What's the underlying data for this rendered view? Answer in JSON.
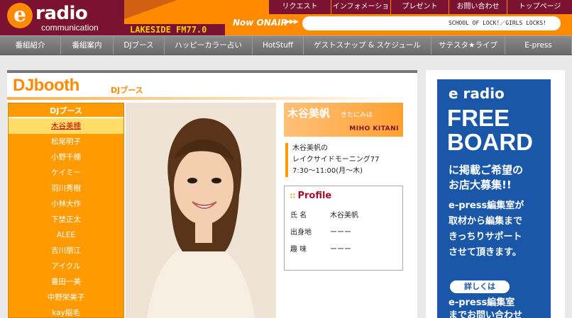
{
  "header": {
    "logo_mark": "e",
    "logo_word": "radio",
    "logo_sub": "communication",
    "station": "LAKESIDE FM77.0",
    "now_onair_label": "Now ONAIR",
    "now_onair_arrows": "▶▶▶",
    "now_onair_text": "SCHOOL OF LOCK!／GIRLS LOCKS!"
  },
  "topnav": [
    {
      "label": "リクエスト"
    },
    {
      "label": "インフォメーション"
    },
    {
      "label": "プレゼント"
    },
    {
      "label": "お問い合わせ"
    },
    {
      "label": "トップページ"
    }
  ],
  "mainnav": [
    {
      "label": "番組紹介"
    },
    {
      "label": "番組案内"
    },
    {
      "label": "DJブース"
    },
    {
      "label": "ハッピーカラー占い"
    },
    {
      "label": "HotStuff"
    },
    {
      "label": "ゲストスナップ & スケジュール"
    },
    {
      "label": "サテスタ★ライブ"
    },
    {
      "label": "E-press"
    }
  ],
  "page": {
    "title": "DJbooth",
    "subtitle": "DJブース"
  },
  "dj_list": {
    "header": "DJブース",
    "items": [
      {
        "label": "木谷美穂"
      },
      {
        "label": "松尾明子"
      },
      {
        "label": "小野千穂"
      },
      {
        "label": "ケイミー"
      },
      {
        "label": "羽川秀樹"
      },
      {
        "label": "小林大作"
      },
      {
        "label": "下埜正太"
      },
      {
        "label": "ALEE"
      },
      {
        "label": "吉川朋江"
      },
      {
        "label": "アイクル"
      },
      {
        "label": "豊田一美"
      },
      {
        "label": "中野栄美子"
      },
      {
        "label": "kay稲毛"
      }
    ]
  },
  "dj": {
    "name": "木谷美帆",
    "reading": "きたにみほ",
    "romaji": "MIHO KITANI",
    "program_lines": [
      "木谷美帆の",
      "レイクサイドモーニング77",
      "7:30〜11:00(月〜木)"
    ]
  },
  "profile": {
    "title": "Profile",
    "rows": [
      {
        "label": "氏 名",
        "value": "木谷美帆"
      },
      {
        "label": "出身地",
        "value": "ーーー"
      },
      {
        "label": "趣 味",
        "value": "ーーー"
      }
    ]
  },
  "ad": {
    "logo": "e radio",
    "free_line1": "FREE",
    "free_line2": "BOARD",
    "text1_line1": "に掲載ご希望の",
    "text1_line2": "お店大募集!!",
    "text2_line1": "e-press編集室が",
    "text2_line2": "取材から編集まで",
    "text2_line3": "きっちりサポート",
    "text2_line4": "させて頂きます。",
    "details_button": "詳しくは",
    "text3_line1": "e-press編集室",
    "text3_line2": "までお問い合わせ"
  }
}
